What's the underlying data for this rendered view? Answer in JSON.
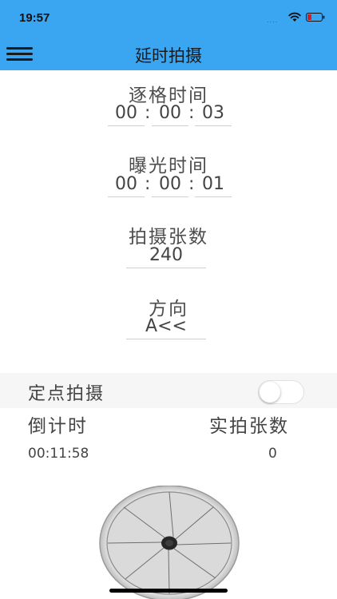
{
  "status_bar": {
    "time": "19:57",
    "signal": "....",
    "icons": [
      "wifi-icon",
      "battery-icon"
    ]
  },
  "nav": {
    "title": "延时拍摄",
    "menu_icon": "hamburger-menu-icon",
    "color": "#3aa5f0"
  },
  "interval": {
    "label": "逐格时间",
    "hours": "00",
    "minutes": "00",
    "seconds": "03",
    "separator": ":"
  },
  "exposure": {
    "label": "曝光时间",
    "hours": "00",
    "minutes": "00",
    "seconds": "01",
    "separator": ":"
  },
  "shot_count": {
    "label": "拍摄张数",
    "value": "240"
  },
  "direction": {
    "label": "方向",
    "value": "A<<"
  },
  "fixed_point": {
    "label": "定点拍摄",
    "enabled": false
  },
  "countdown": {
    "label": "倒计时",
    "value": "00:11:58"
  },
  "actual_count": {
    "label": "实拍张数",
    "value": "0"
  },
  "shutter_icon": "camera-shutter-icon"
}
